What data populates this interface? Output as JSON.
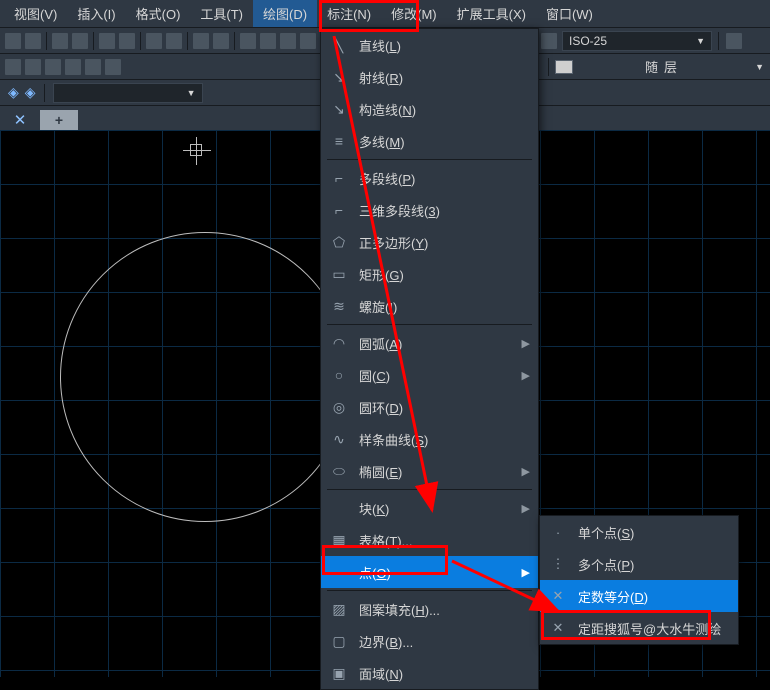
{
  "menubar": {
    "items": [
      {
        "label": "视图(V)"
      },
      {
        "label": "插入(I)"
      },
      {
        "label": "格式(O)"
      },
      {
        "label": "工具(T)"
      },
      {
        "label": "绘图(D)",
        "active": true
      },
      {
        "label": "标注(N)"
      },
      {
        "label": "修改(M)"
      },
      {
        "label": "扩展工具(X)"
      },
      {
        "label": "窗口(W)"
      }
    ]
  },
  "dimstyle": {
    "current": "ISO-25"
  },
  "layer": {
    "bylayer": "随层"
  },
  "draw_menu": {
    "items": [
      {
        "label": "直线(L)",
        "icon": "╲"
      },
      {
        "label": "射线(R)",
        "icon": "↘"
      },
      {
        "label": "构造线(N)",
        "icon": "↘"
      },
      {
        "label": "多线(M)",
        "icon": "≡"
      },
      {
        "sep": true
      },
      {
        "label": "多段线(P)",
        "icon": "⌐"
      },
      {
        "label": "三维多段线(3)",
        "icon": "⌐"
      },
      {
        "label": "正多边形(Y)",
        "icon": "⬠"
      },
      {
        "label": "矩形(G)",
        "icon": "▭"
      },
      {
        "label": "螺旋(I)",
        "icon": "≋"
      },
      {
        "sep": true
      },
      {
        "label": "圆弧(A)",
        "icon": "◠",
        "sub": true
      },
      {
        "label": "圆(C)",
        "icon": "○",
        "sub": true
      },
      {
        "label": "圆环(D)",
        "icon": "◎"
      },
      {
        "label": "样条曲线(S)",
        "icon": "∿"
      },
      {
        "label": "椭圆(E)",
        "icon": "⬭",
        "sub": true
      },
      {
        "sep": true
      },
      {
        "label": "块(K)",
        "icon": "",
        "sub": true
      },
      {
        "label": "表格(T)...",
        "icon": "▦"
      },
      {
        "label": "点(O)",
        "icon": "·",
        "sub": true,
        "hl": true
      },
      {
        "sep": true
      },
      {
        "label": "图案填充(H)...",
        "icon": "▨"
      },
      {
        "label": "边界(B)...",
        "icon": "▢"
      },
      {
        "label": "面域(N)",
        "icon": "▣"
      }
    ]
  },
  "point_submenu": {
    "items": [
      {
        "label": "单个点(S)",
        "icon": "·"
      },
      {
        "label": "多个点(P)",
        "icon": "⋮"
      },
      {
        "label": "定数等分(D)",
        "icon": "✕",
        "hl": true
      },
      {
        "label": "定距搜狐号@大水牛测绘",
        "icon": "✕"
      }
    ]
  }
}
